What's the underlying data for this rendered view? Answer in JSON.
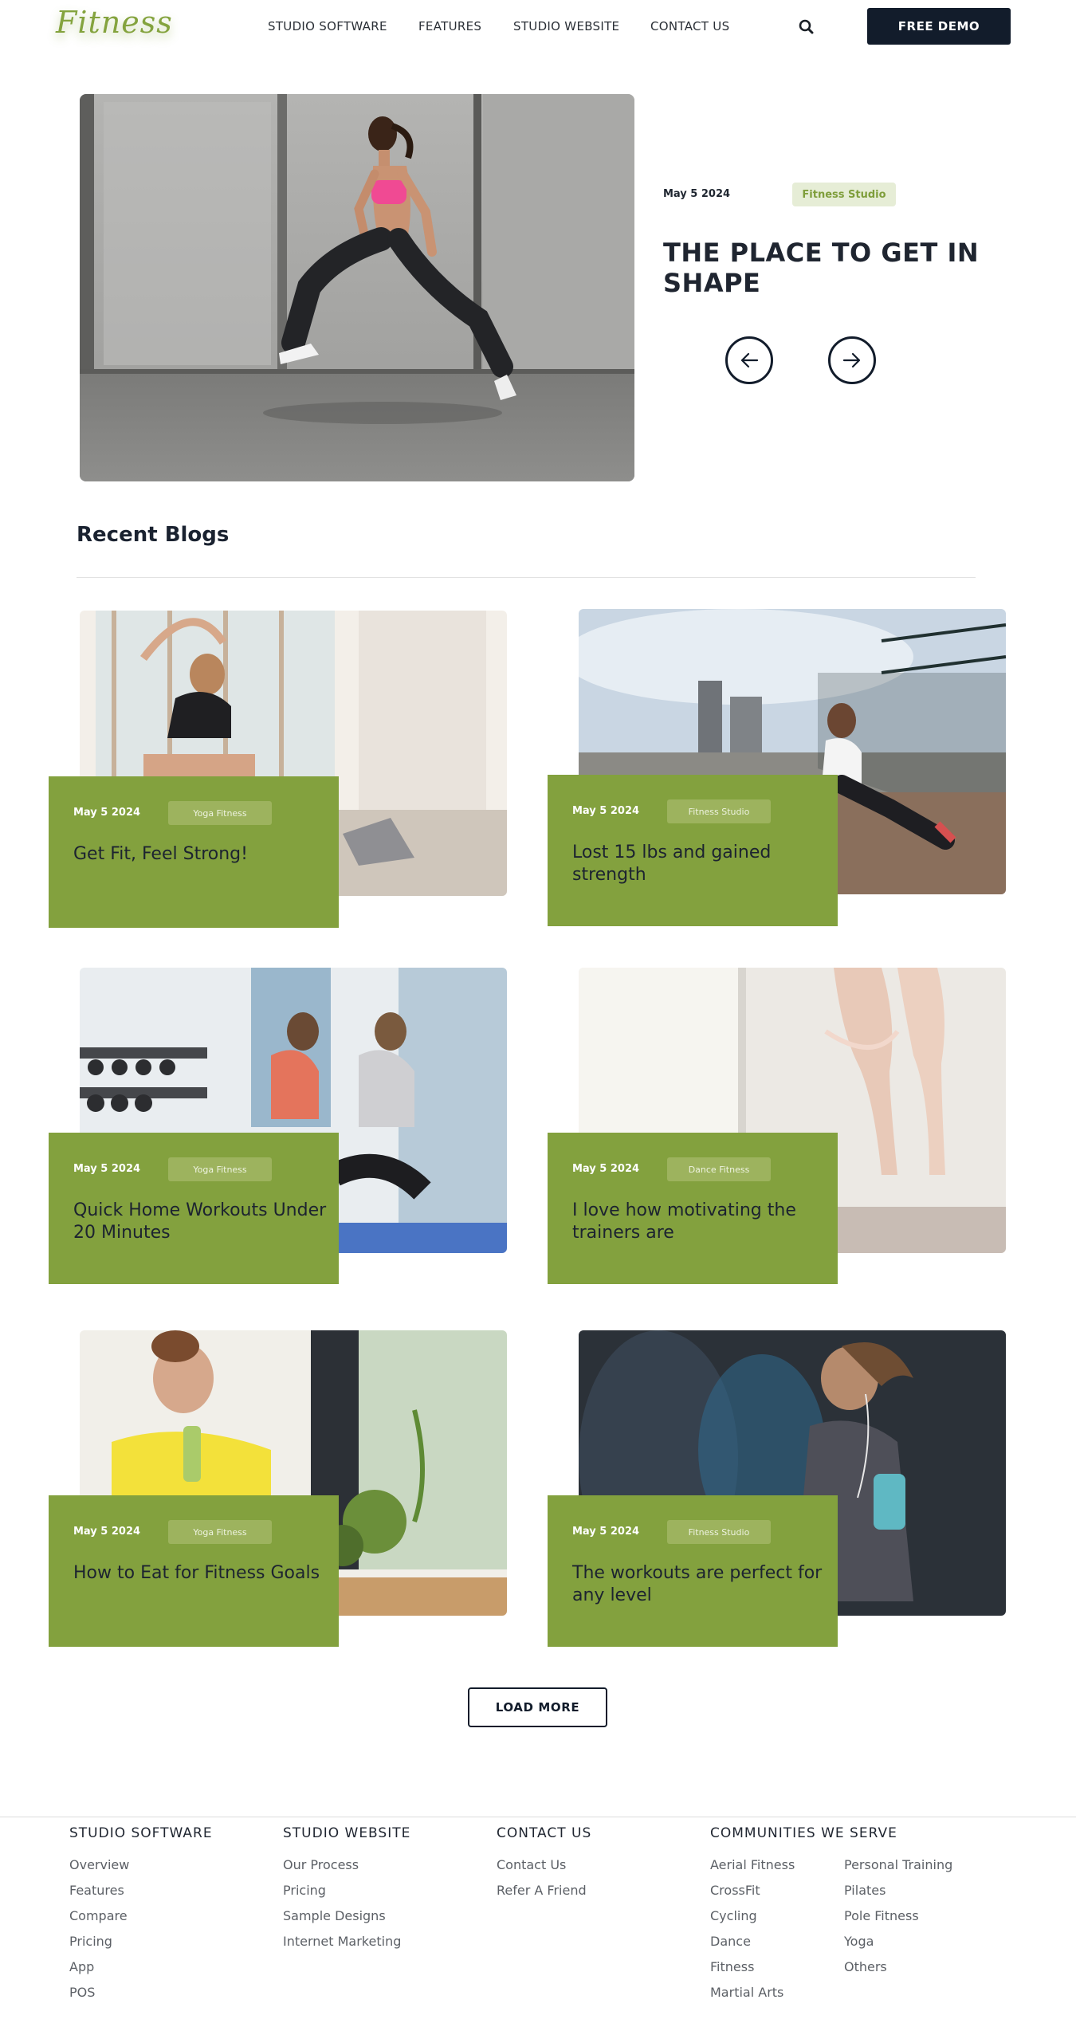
{
  "header": {
    "logo": "Fitness",
    "nav": [
      "STUDIO SOFTWARE",
      "FEATURES",
      "STUDIO WEBSITE",
      "CONTACT US"
    ],
    "demo_button": "FREE DEMO"
  },
  "hero": {
    "date": "May 5 2024",
    "tag": "Fitness Studio",
    "title": "THE PLACE TO GET IN SHAPE"
  },
  "blogs": {
    "title": "Recent Blogs",
    "load_more": "LOAD MORE",
    "posts": [
      {
        "date": "May 5 2024",
        "tag": "Yoga Fitness",
        "title": "Get Fit, Feel Strong!"
      },
      {
        "date": "May 5 2024",
        "tag": "Fitness Studio",
        "title": "Lost 15 lbs and gained strength"
      },
      {
        "date": "May 5 2024",
        "tag": "Yoga Fitness",
        "title": "Quick Home Workouts Under 20 Minutes"
      },
      {
        "date": "May 5 2024",
        "tag": "Dance Fitness",
        "title": "I love how motivating the trainers are"
      },
      {
        "date": "May 5 2024",
        "tag": "Yoga Fitness",
        "title": "How to Eat for Fitness Goals"
      },
      {
        "date": "May 5 2024",
        "tag": "Fitness Studio",
        "title": "The workouts are perfect for any level"
      }
    ]
  },
  "footer": {
    "studio_software": {
      "title": "STUDIO SOFTWARE",
      "links": [
        "Overview",
        "Features",
        "Compare",
        "Pricing",
        "App",
        "POS"
      ]
    },
    "studio_website": {
      "title": "STUDIO WEBSITE",
      "links": [
        "Our Process",
        "Pricing",
        "Sample Designs",
        "Internet Marketing"
      ]
    },
    "contact_us": {
      "title": "CONTACT US",
      "links": [
        "Contact Us",
        "Refer A Friend"
      ]
    },
    "communities": {
      "title": "COMMUNITIES WE SERVE",
      "links_a": [
        "Aerial Fitness",
        "CrossFit",
        "Cycling",
        "Dance",
        "Fitness",
        "Martial Arts"
      ],
      "links_b": [
        "Personal Training",
        "Pilates",
        "Pole Fitness",
        "Yoga",
        "Others"
      ]
    }
  },
  "colors": {
    "accent": "#83a13e",
    "dark": "#121c2b",
    "tag_bg": "#e6edd6"
  }
}
